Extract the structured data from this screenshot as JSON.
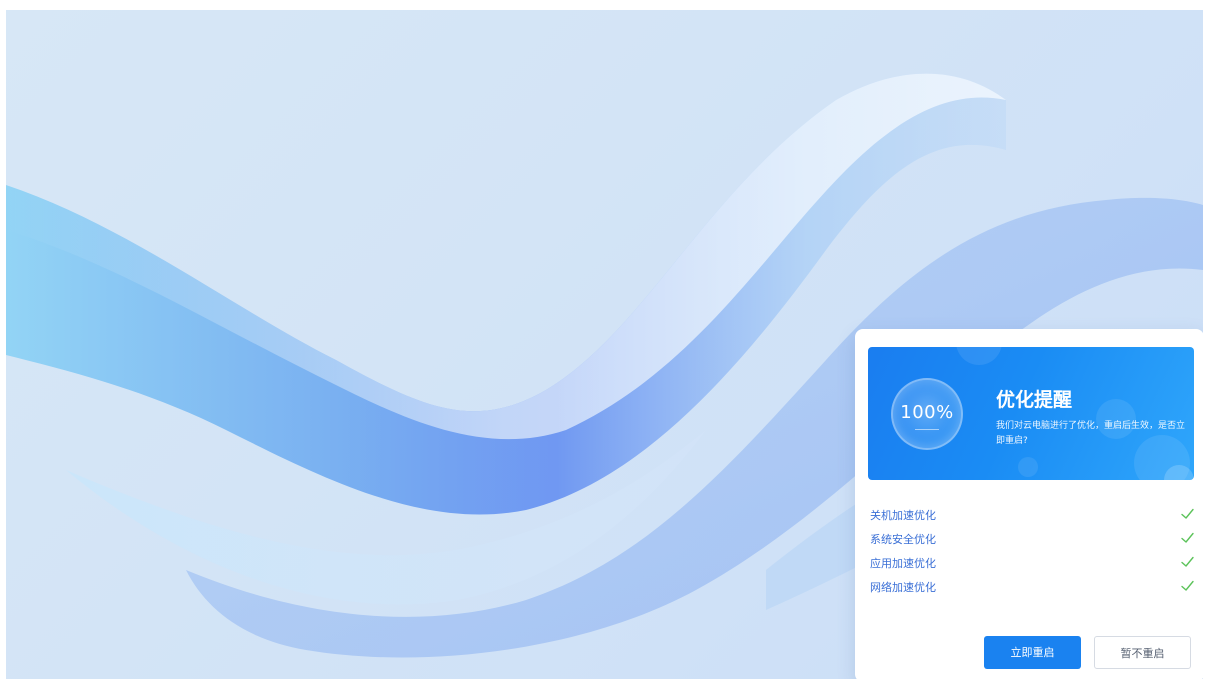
{
  "dialog": {
    "progress": "100%",
    "title": "优化提醒",
    "description": "我们对云电脑进行了优化，重启后生效，是否立即重启?",
    "items": [
      {
        "label": "关机加速优化"
      },
      {
        "label": "系统安全优化"
      },
      {
        "label": "应用加速优化"
      },
      {
        "label": "网络加速优化"
      }
    ],
    "primary_button": "立即重启",
    "secondary_button": "暂不重启"
  },
  "colors": {
    "accent": "#1a82f0",
    "check": "#5cc35a",
    "item_text": "#3a6fd6"
  }
}
